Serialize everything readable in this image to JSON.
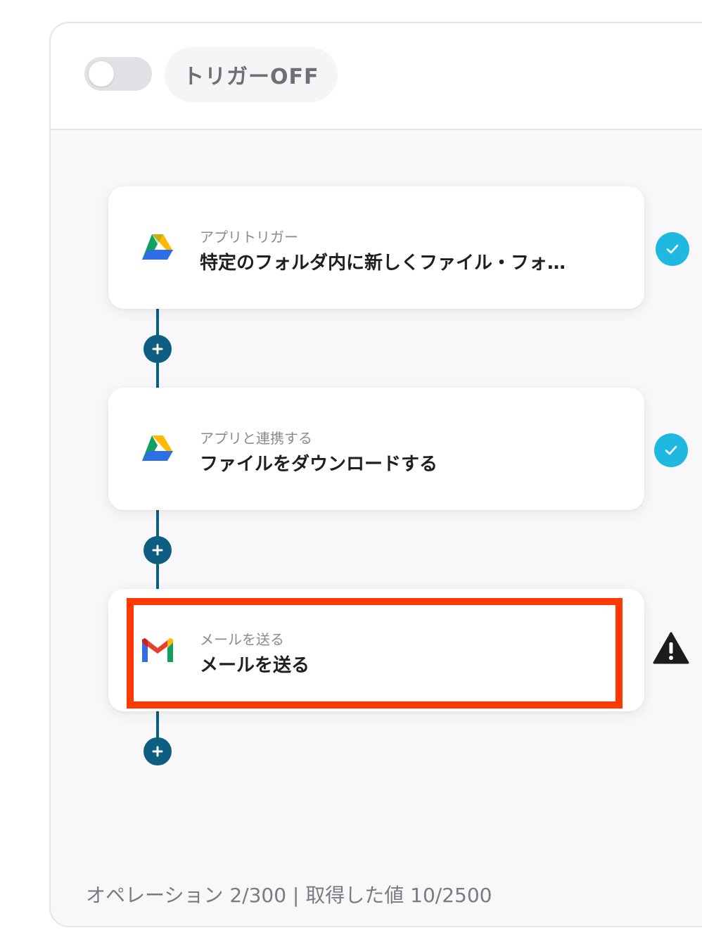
{
  "header": {
    "toggle_state": "off",
    "trigger_label": "トリガーOFF"
  },
  "steps": [
    {
      "subtitle": "アプリトリガー",
      "title": "特定のフォルダ内に新しくファイル・フォ…",
      "icon": "google-drive-icon",
      "status": "complete",
      "status_icon": "check-icon"
    },
    {
      "subtitle": "アプリと連携する",
      "title": "ファイルをダウンロードする",
      "icon": "google-drive-icon",
      "status": "complete",
      "status_icon": "check-icon"
    },
    {
      "subtitle": "メールを送る",
      "title": "メールを送る",
      "icon": "gmail-icon",
      "status": "warning",
      "status_icon": "warning-icon",
      "highlighted": true
    }
  ],
  "footer": {
    "text": "オペレーション 2/300 | 取得した値 10/2500"
  },
  "colors": {
    "connector": "#0d5e80",
    "check": "#1fb8e0",
    "highlight": "#ff3a00"
  }
}
